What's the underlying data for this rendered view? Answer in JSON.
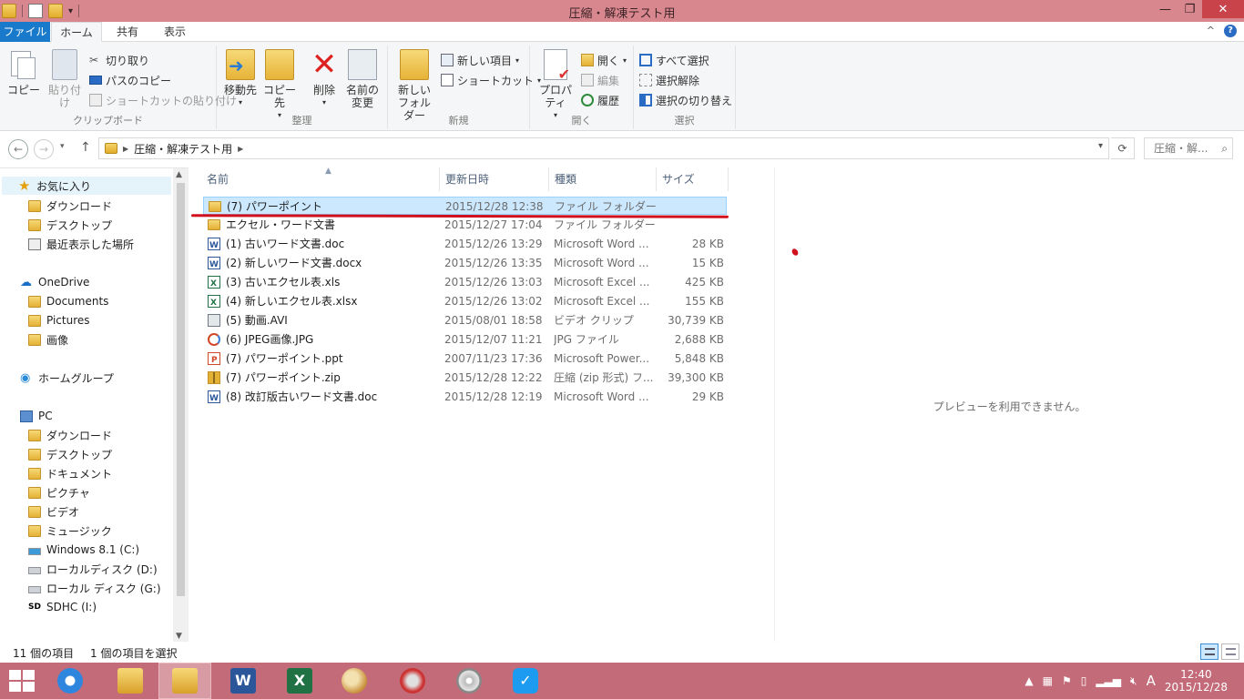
{
  "window": {
    "title": "圧縮・解凍テスト用",
    "minimize": "—",
    "maximize": "❐",
    "close": "✕"
  },
  "tabs": {
    "file": "ファイル",
    "home": "ホーム",
    "share": "共有",
    "view": "表示",
    "collapse": "^"
  },
  "ribbon": {
    "clipboard": {
      "label": "クリップボード",
      "copy": "コピー",
      "paste": "貼り付け",
      "cut": "切り取り",
      "copy_path": "パスのコピー",
      "paste_shortcut": "ショートカットの貼り付け"
    },
    "organize": {
      "label": "整理",
      "move_to": "移動先",
      "copy_to": "コピー先",
      "delete": "削除",
      "rename_1": "名前の",
      "rename_2": "変更"
    },
    "new": {
      "label": "新規",
      "new_folder_1": "新しい",
      "new_folder_2": "フォルダー",
      "new_item": "新しい項目",
      "shortcut": "ショートカット"
    },
    "open": {
      "label": "開く",
      "properties": "プロパティ",
      "open": "開く",
      "edit": "編集",
      "history": "履歴"
    },
    "select": {
      "label": "選択",
      "select_all": "すべて選択",
      "select_none": "選択解除",
      "invert": "選択の切り替え"
    }
  },
  "address": {
    "path": "圧縮・解凍テスト用",
    "search_placeholder": "圧縮・解..."
  },
  "nav": {
    "favorites": "お気に入り",
    "fav_items": [
      "ダウンロード",
      "デスクトップ",
      "最近表示した場所"
    ],
    "onedrive": "OneDrive",
    "onedrive_items": [
      "Documents",
      "Pictures",
      "画像"
    ],
    "homegroup": "ホームグループ",
    "pc": "PC",
    "pc_items": [
      "ダウンロード",
      "デスクトップ",
      "ドキュメント",
      "ピクチャ",
      "ビデオ",
      "ミュージック",
      "Windows 8.1 (C:)",
      "ローカルディスク (D:)",
      "ローカル ディスク (G:)",
      "SDHC (I:)"
    ]
  },
  "columns": {
    "name": "名前",
    "date": "更新日時",
    "type": "種類",
    "size": "サイズ"
  },
  "files": [
    {
      "name": "(7) パワーポイント",
      "date": "2015/12/28 12:38",
      "type": "ファイル フォルダー",
      "size": "",
      "icon": "folder"
    },
    {
      "name": "エクセル・ワード文書",
      "date": "2015/12/27 17:04",
      "type": "ファイル フォルダー",
      "size": "",
      "icon": "folder"
    },
    {
      "name": "(1) 古いワード文書.doc",
      "date": "2015/12/26 13:29",
      "type": "Microsoft Word ...",
      "size": "28 KB",
      "icon": "word"
    },
    {
      "name": "(2) 新しいワード文書.docx",
      "date": "2015/12/26 13:35",
      "type": "Microsoft Word ...",
      "size": "15 KB",
      "icon": "word"
    },
    {
      "name": "(3) 古いエクセル表.xls",
      "date": "2015/12/26 13:03",
      "type": "Microsoft Excel ...",
      "size": "425 KB",
      "icon": "excel"
    },
    {
      "name": "(4) 新しいエクセル表.xlsx",
      "date": "2015/12/26 13:02",
      "type": "Microsoft Excel ...",
      "size": "155 KB",
      "icon": "excel"
    },
    {
      "name": "(5) 動画.AVI",
      "date": "2015/08/01 18:58",
      "type": "ビデオ クリップ",
      "size": "30,739 KB",
      "icon": "video"
    },
    {
      "name": "(6)  JPEG画像.JPG",
      "date": "2015/12/07 11:21",
      "type": "JPG ファイル",
      "size": "2,688 KB",
      "icon": "jpg"
    },
    {
      "name": "(7) パワーポイント.ppt",
      "date": "2007/11/23 17:36",
      "type": "Microsoft Power...",
      "size": "5,848 KB",
      "icon": "ppt"
    },
    {
      "name": "(7) パワーポイント.zip",
      "date": "2015/12/28 12:22",
      "type": "圧縮 (zip 形式) フ...",
      "size": "39,300 KB",
      "icon": "zip"
    },
    {
      "name": "(8) 改訂版古いワード文書.doc",
      "date": "2015/12/28 12:19",
      "type": "Microsoft Word ...",
      "size": "29 KB",
      "icon": "word"
    }
  ],
  "preview": {
    "message": "プレビューを利用できません。"
  },
  "status": {
    "item_count": "11 個の項目",
    "selected": "1 個の項目を選択"
  },
  "taskbar": {
    "time": "12:40",
    "date": "2015/12/28",
    "ime": "A",
    "word_letter": "W",
    "excel_letter": "X"
  }
}
